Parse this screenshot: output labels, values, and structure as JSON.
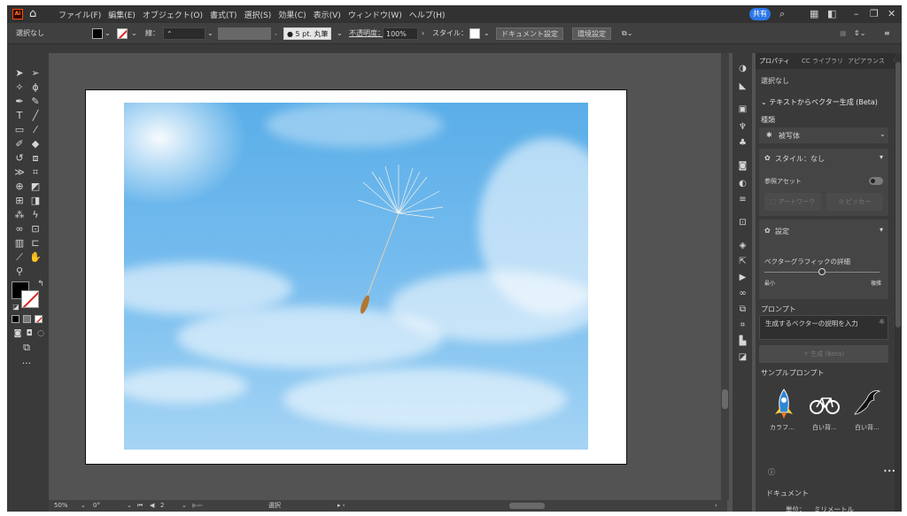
{
  "app": {
    "logo_text": "Ai",
    "menu": [
      "ファイル(F)",
      "編集(E)",
      "オブジェクト(O)",
      "書式(T)",
      "選択(S)",
      "効果(C)",
      "表示(V)",
      "ウィンドウ(W)",
      "ヘルプ(H)"
    ],
    "share_label": "共有"
  },
  "control_bar": {
    "selection_label": "選択なし",
    "stroke_label": "線：",
    "brush_label": "5 pt. 丸筆",
    "opacity_label": "不透明度：",
    "opacity_value": "100%",
    "style_label": "スタイル：",
    "document_setup_label": "ドキュメント設定",
    "preferences_label": "環境設定"
  },
  "status_bar": {
    "zoom": "50%",
    "rotation": "0°",
    "artboard_number": "2",
    "tool_name": "選択"
  },
  "properties_panel": {
    "tabs": [
      "プロパティ",
      "CC ライブラリ",
      "アピアランス"
    ],
    "selection": "選択なし",
    "section_title": "テキストからベクター生成 (Beta)",
    "type_label": "種類",
    "type_value": "被写体",
    "style_value": "スタイル：なし",
    "reference_asset_label": "参照アセット",
    "artwork_button": "アートワーク",
    "picker_button": "ピッカー",
    "settings_label": "設定",
    "detail_label": "ベクターグラフィックの詳細",
    "detail_min": "最小",
    "detail_max": "複雑",
    "detail_level": 0.5,
    "prompt_label": "プロンプト",
    "prompt_placeholder": "生成するベクターの説明を入力",
    "generate_button": "生成 (Beta)",
    "sample_prompts_label": "サンプルプロンプト",
    "samples": [
      "カラフ...",
      "白い背...",
      "白い背..."
    ],
    "document_label": "ドキュメント",
    "unit_label": "単位：",
    "unit_value": "ミリメートル"
  },
  "colors": {
    "app_bg": "#535353",
    "panel_bg": "#3a3a3a",
    "accent": "#2c76e8",
    "sky_top": "#5aaee8",
    "sky_bottom": "#a6d4f4"
  }
}
